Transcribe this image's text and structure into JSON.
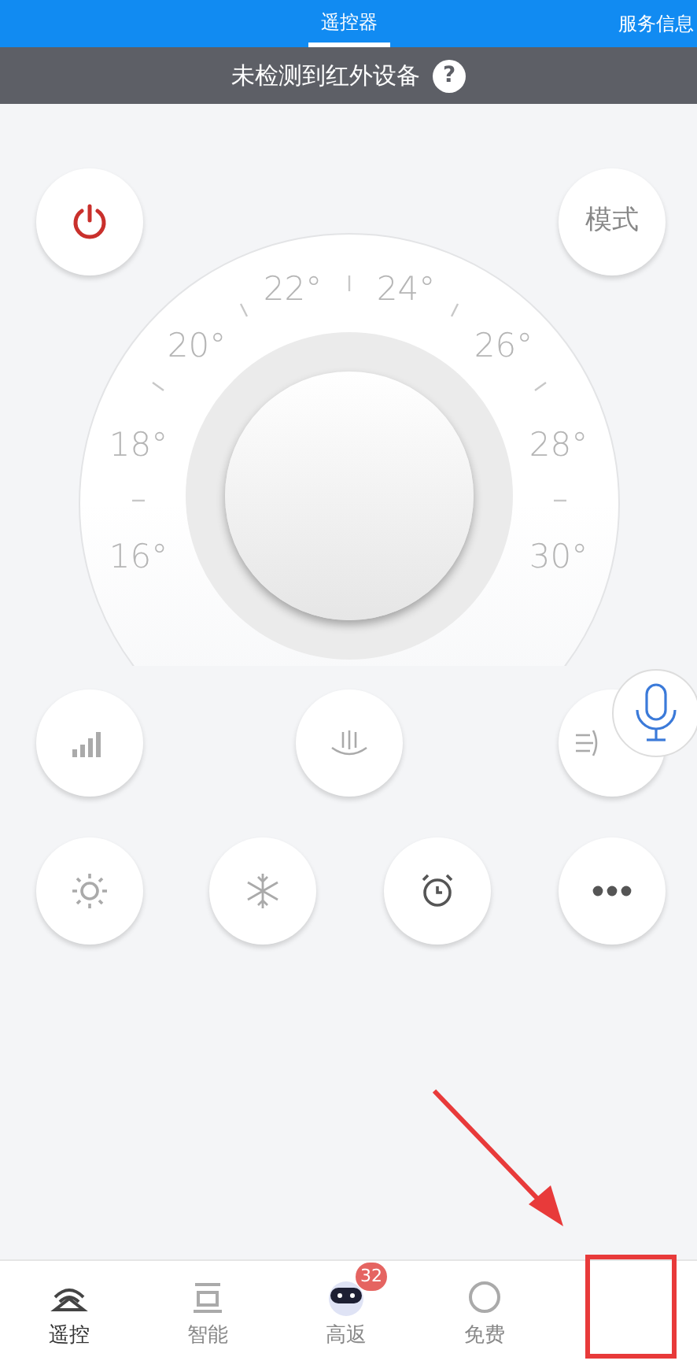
{
  "header": {
    "tabs": [
      {
        "label": "遥控器",
        "selected": true
      },
      {
        "label": "服务信息",
        "selected": false
      }
    ]
  },
  "notice": {
    "text": "未检测到红外设备",
    "help": "?"
  },
  "mode_button": "模式",
  "dial": {
    "labels": [
      "22°",
      "24°",
      "20°",
      "26°",
      "18°",
      "28°",
      "16°",
      "30°"
    ]
  },
  "tab_bar": [
    {
      "label": "遥控",
      "selected": true
    },
    {
      "label": "智能",
      "selected": false
    },
    {
      "label": "高返",
      "selected": false,
      "badge": "32"
    },
    {
      "label": "免费",
      "selected": false
    }
  ]
}
